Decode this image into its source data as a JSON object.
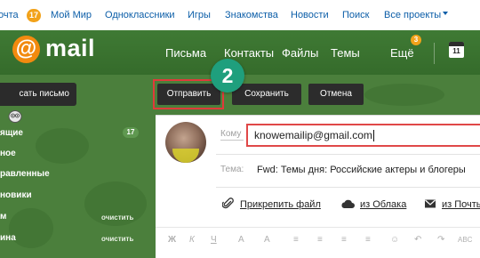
{
  "topbar": {
    "items": [
      "очта",
      "Мой Мир",
      "Одноклассники",
      "Игры",
      "Знакомства",
      "Новости",
      "Поиск",
      "Все проекты"
    ],
    "mail_count": "17"
  },
  "header": {
    "logo_at": "@",
    "logo_text": "mail",
    "nav": [
      "Письма",
      "Контакты",
      "Файлы",
      "Темы",
      "Ещё"
    ],
    "more_badge": "3",
    "calendar_day": "11"
  },
  "sidebar": {
    "compose_label": "сать письмо",
    "items": [
      "ящие",
      "ное",
      "равленные",
      "новики",
      "м",
      "ина"
    ],
    "inbox_count": "17",
    "clear_label": "очистить"
  },
  "toolbar": {
    "send": "Отправить",
    "save": "Сохранить",
    "cancel": "Отмена"
  },
  "step_marker": "2",
  "compose": {
    "to_label": "Кому",
    "to_value": "knowemailip@gmail.com",
    "subject_label": "Тема:",
    "subject_value": "Fwd: Темы дня: Российские актеры и блогеры",
    "attach_file": "Прикрепить файл",
    "from_cloud": "из Облака",
    "from_mail": "из Почты",
    "format_buttons": [
      "Ж",
      "К",
      "Ч",
      "A",
      "A",
      "≡",
      "≡",
      "≡",
      "≡",
      "☺",
      "↶",
      "↷",
      "ABC"
    ]
  },
  "colors": {
    "header_green": "#3f7a34",
    "accent_orange": "#f28a0f",
    "highlight_red": "#e03a3a",
    "step_teal": "#1f9f7d",
    "link_blue": "#0c5ea8"
  }
}
